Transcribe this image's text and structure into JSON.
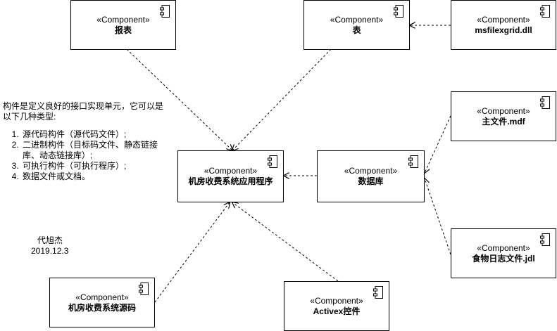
{
  "stereotype": "«Component»",
  "components": {
    "report": "报表",
    "table": "表",
    "msfilexgrid": "msfilexgrid.dll",
    "main_file": "主文件.mdf",
    "app": "机房收费系统应用程序",
    "database": "数据库",
    "log_file": "食物日志文件.jdl",
    "source": "机房收费系统源码",
    "activex": "Activex控件"
  },
  "note": {
    "intro": "构件是定义良好的接口实现单元，它可以是以下几种类型:",
    "items": [
      "源代码构件（源代码文件）;",
      "二进制构件（目标码文件、静态链接库、动态链接库）;",
      "可执行构件（可执行程序）;",
      "数据文件或文档。"
    ]
  },
  "author": {
    "name": "代旭杰",
    "date": "2019.12.3"
  }
}
